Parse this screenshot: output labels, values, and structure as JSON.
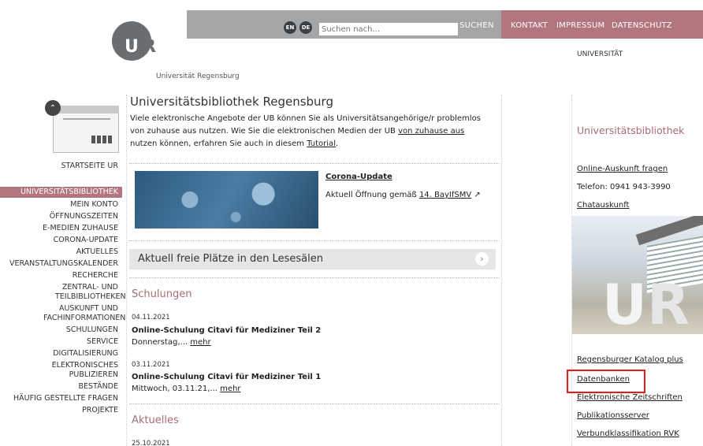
{
  "header": {
    "lang_en": "EN",
    "lang_de": "DE",
    "search_placeholder": "Suchen nach...",
    "search_button": "SUCHEN",
    "meta_links": [
      "KONTAKT",
      "IMPRESSUM",
      "DATENSCHUTZ"
    ],
    "universitaet": "UNIVERSITÄT",
    "logo_text": "Universität Regensburg",
    "logo_u": "U",
    "logo_r": "R"
  },
  "left": {
    "start_label": "STARTSEITE UR",
    "nav": [
      "UNIVERSITÄTSBIBLIOTHEK",
      "MEIN KONTO",
      "ÖFFNUNGSZEITEN",
      "E-MEDIEN ZUHAUSE",
      "CORONA-UPDATE",
      "AKTUELLES",
      "VERANSTALTUNGSKALENDER",
      "RECHERCHE",
      "ZENTRAL- UND TEILBIBLIOTHEKEN",
      "AUSKUNFT UND FACHINFORMATIONEN",
      "SCHULUNGEN",
      "SERVICE",
      "DIGITALISIERUNG",
      "ELEKTRONISCHES PUBLIZIEREN",
      "BESTÄNDE",
      "HÄUFIG GESTELLTE FRAGEN",
      "PROJEKTE"
    ]
  },
  "main": {
    "title": "Universitätsbibliothek Regensburg",
    "intro_1": "Viele elektronische Angebote der UB können Sie als Universitätsangehörige/r problemlos von zuhause aus nutzen. Wie Sie die elektronischen Medien der UB ",
    "intro_link_1": "von zuhause aus",
    "intro_2": " nutzen können, erfahren Sie auch in diesem ",
    "intro_link_2": "Tutorial",
    "intro_3": ".",
    "corona_title": "Corona-Update",
    "corona_text": "Aktuell Öffnung gemäß ",
    "corona_link": "14. BayIfSMV",
    "plaetze": "Aktuell freie Plätze in den Lesesälen",
    "schulungen_title": "Schulungen",
    "events": [
      {
        "date": "04.11.2021",
        "title": "Online-Schulung Citavi für Mediziner Teil 2",
        "text": "Donnerstag,... ",
        "more": "mehr"
      },
      {
        "date": "03.11.2021",
        "title": "Online-Schulung Citavi für Mediziner Teil 1",
        "text": "Mittwoch, 03.11.21,... ",
        "more": "mehr"
      }
    ],
    "aktuelles_title": "Aktuelles",
    "aktuelles_date": "25.10.2021"
  },
  "right": {
    "title": "Universitätsbibliothek",
    "auskunft": "Online-Auskunft fragen",
    "telefon": "Telefon: 0941 943-3990",
    "chat": "Chatauskunft",
    "links": [
      "Regensburger Katalog plus",
      "Datenbanken",
      "Elektronische Zeitschriften",
      "Publikationsserver",
      "Verbundklassifikation RVK"
    ]
  }
}
